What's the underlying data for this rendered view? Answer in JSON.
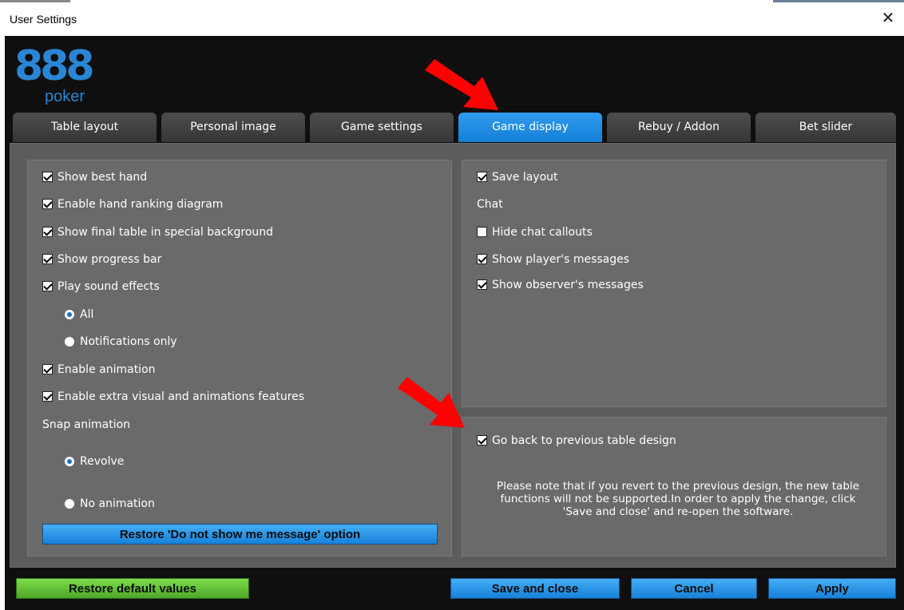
{
  "window": {
    "title": "User Settings",
    "close_glyph": "✕"
  },
  "logo": {
    "number": "888",
    "word": "poker"
  },
  "tabs": [
    {
      "label": "Table layout",
      "active": false
    },
    {
      "label": "Personal image",
      "active": false
    },
    {
      "label": "Game settings",
      "active": false
    },
    {
      "label": "Game display",
      "active": true
    },
    {
      "label": "Rebuy / Addon",
      "active": false
    },
    {
      "label": "Bet slider",
      "active": false
    }
  ],
  "left_panel": {
    "show_best_hand": {
      "label": "Show best hand",
      "checked": true
    },
    "hand_ranking": {
      "label": "Enable hand ranking diagram",
      "checked": true
    },
    "final_table_bg": {
      "label": "Show final table in special background",
      "checked": true
    },
    "progress_bar": {
      "label": "Show progress bar",
      "checked": true
    },
    "sound_effects": {
      "label": "Play sound effects",
      "checked": true
    },
    "sound_all": {
      "label": "All",
      "selected": true
    },
    "sound_notifications": {
      "label": "Notifications only",
      "selected": false
    },
    "animation": {
      "label": "Enable animation",
      "checked": true
    },
    "extra_visual": {
      "label": "Enable extra visual and animations features",
      "checked": true
    },
    "snap_animation_label": "Snap animation",
    "snap_revolve": {
      "label": "Revolve",
      "selected": true
    },
    "snap_none": {
      "label": "No animation",
      "selected": false
    },
    "restore_message_button": "Restore 'Do not show me message' option"
  },
  "right_panel": {
    "save_layout": {
      "label": "Save layout",
      "checked": true
    },
    "chat_label": "Chat",
    "hide_chat_callouts": {
      "label": "Hide chat callouts",
      "checked": false
    },
    "show_player_messages": {
      "label": "Show player's messages",
      "checked": true
    },
    "show_observer_messages": {
      "label": "Show observer's messages",
      "checked": true
    }
  },
  "design_panel": {
    "go_back": {
      "label": "Go back to previous table design",
      "checked": true
    },
    "note": "Please note that if you revert to the previous design, the new table functions will not be supported.In order to apply the change, click 'Save and close' and re-open the software."
  },
  "footer": {
    "restore_defaults": "Restore default values",
    "save_close": "Save and close",
    "cancel": "Cancel",
    "apply": "Apply"
  },
  "colors": {
    "accent_blue": "#1e88e5",
    "tab_active": "#1a8ae0",
    "restore_green": "#5cbf32",
    "panel_gray": "#6a6a6a",
    "annotation_arrow": "#ff0000"
  }
}
